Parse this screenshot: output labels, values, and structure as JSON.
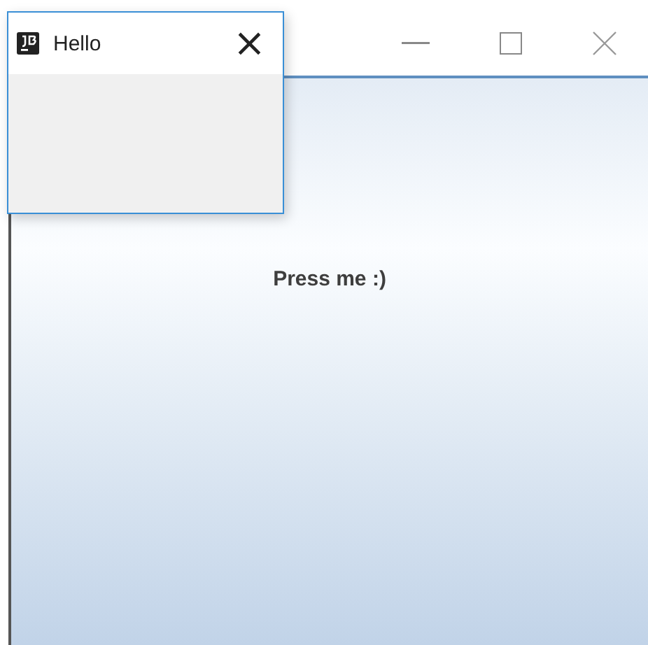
{
  "main_window": {
    "button": {
      "label": "Press me :)"
    }
  },
  "dialog": {
    "title": "Hello",
    "close_glyph": "×"
  }
}
